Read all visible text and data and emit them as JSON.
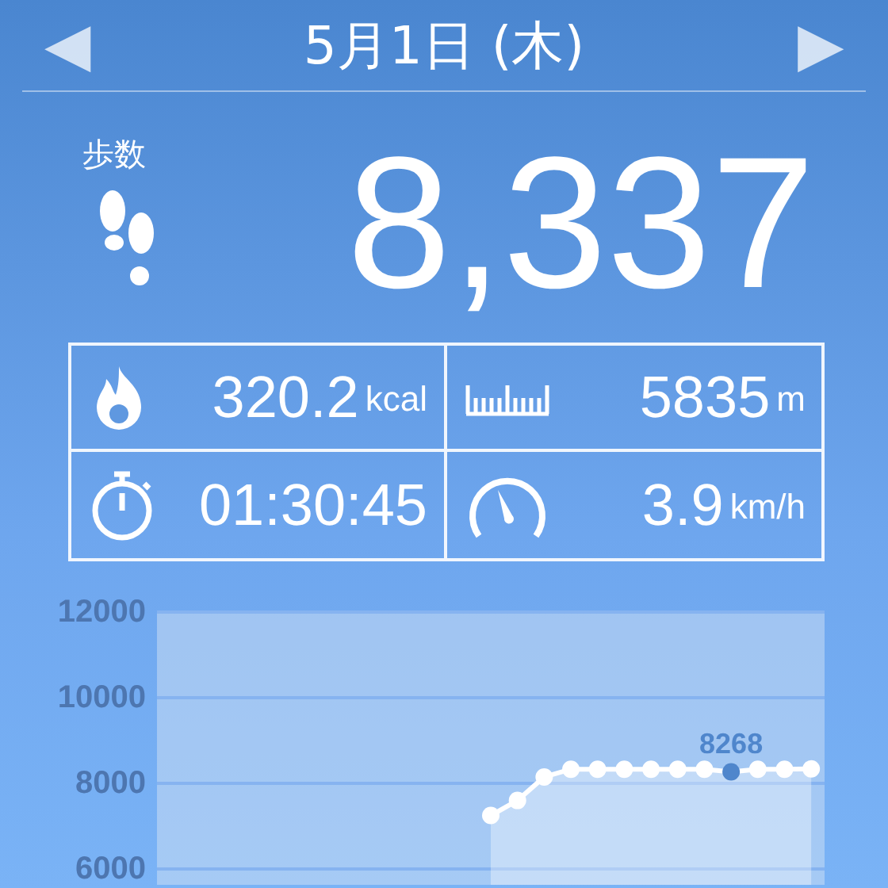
{
  "header": {
    "date": "5月1日 (木)",
    "prev": "◀",
    "next": "▶"
  },
  "steps": {
    "label": "歩数",
    "value": "8,337"
  },
  "stats": [
    {
      "kind": "calories",
      "value": "320.2",
      "unit": "kcal"
    },
    {
      "kind": "distance",
      "value": "5835",
      "unit": "m"
    },
    {
      "kind": "time",
      "value": "01:30:45"
    },
    {
      "kind": "speed",
      "value": "3.9",
      "unit": "km/h"
    }
  ],
  "chart": {
    "chart_data": {
      "type": "line",
      "grid": true,
      "ylim": [
        5630,
        12000
      ],
      "yticks": [
        6000,
        8000,
        10000,
        12000
      ],
      "categories": [
        null,
        null,
        null,
        null,
        null,
        null,
        null,
        null,
        null,
        null,
        null,
        null,
        null,
        null,
        null,
        null,
        null,
        null,
        null,
        null,
        null,
        null,
        null,
        null,
        null
      ],
      "series": [
        {
          "color": "#ffffff",
          "marker": "o",
          "values": [
            null,
            null,
            null,
            null,
            null,
            null,
            null,
            null,
            null,
            null,
            null,
            null,
            7250,
            7600,
            8150,
            8330,
            8330,
            8330,
            8330,
            8330,
            8330,
            8268,
            8330,
            8330,
            8337
          ]
        }
      ],
      "value_labels": [
        null,
        null,
        null,
        null,
        null,
        null,
        null,
        null,
        null,
        null,
        null,
        null,
        null,
        null,
        null,
        null,
        null,
        null,
        null,
        null,
        null,
        "8268",
        null,
        null,
        null
      ]
    }
  }
}
